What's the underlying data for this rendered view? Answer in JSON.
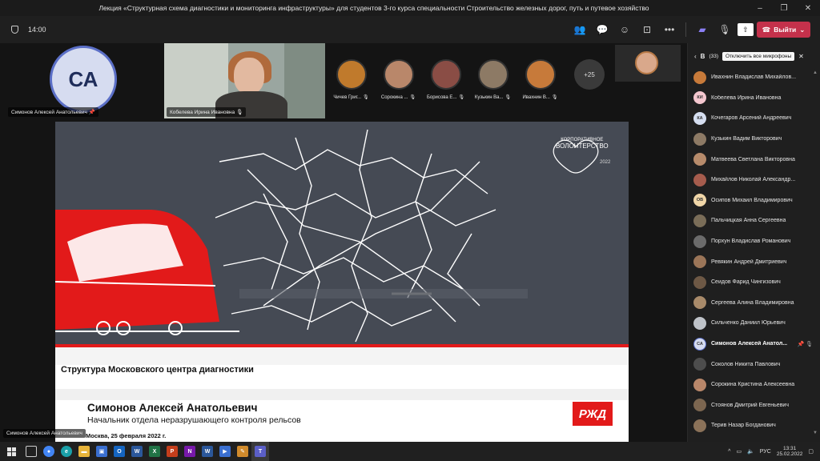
{
  "window": {
    "title": "Лекция «Структурная схема диагностики и мониторинга инфраструктуры» для студентов 3-го курса специальности Строительство железных дорог, путь и путевое хозяйство",
    "controls": [
      "–",
      "❐",
      "✕"
    ]
  },
  "toolbar": {
    "timer": "14:00",
    "leave_label": "Выйти",
    "icons": [
      "people-icon",
      "chat-icon",
      "reactions-icon",
      "rooms-icon",
      "more-icon",
      "camera-off-icon",
      "mic-off-icon",
      "share-icon"
    ]
  },
  "stage": {
    "main_tile_initials": "СА",
    "main_tile_name": "Симонов Алексей Анатольевич",
    "kobeleva_name": "Кобелева Ирина Ивановна",
    "participants": [
      {
        "name": "Чичев Григ...",
        "color": "#c07a2c"
      },
      {
        "name": "Сорокина ...",
        "color": "#b9876a"
      },
      {
        "name": "Борисова Е...",
        "color": "#8a4d45"
      },
      {
        "name": "Кузькин Ва...",
        "color": "#8d7a65"
      },
      {
        "name": "Ивахнин В...",
        "color": "#c77a3a"
      }
    ],
    "more_count": "+25",
    "bottom_name": "Симонов Алексей Анатольевич"
  },
  "slide": {
    "logo_text_top": "КОРПОРАТИВНОЕ",
    "logo_text_main": "ВОЛОНТЕРСТВО",
    "logo_year": "2022",
    "title": "Структура Московского центра диагностики",
    "name": "Симонов Алексей Анатольевич",
    "position": "Начальник отдела неразрушающего контроля рельсов",
    "date": "Москва, 25 февраля 2022 г.",
    "rzd_logo": "РЖД"
  },
  "panel": {
    "header": "В",
    "count": "(33)",
    "tooltip": "Отключить все микрофоны",
    "people": [
      {
        "name": "Ивахнин Владислав Михайлов...",
        "initials": "",
        "color": "#c77a3a"
      },
      {
        "name": "Кобелева Ирина Ивановна",
        "initials": "КИ",
        "color": "#f4c7cf"
      },
      {
        "name": "Кочегаров Арсений Андреевич",
        "initials": "КА",
        "color": "#d5def0"
      },
      {
        "name": "Кузькин Вадим Викторович",
        "initials": "",
        "color": "#8d7a65"
      },
      {
        "name": "Матвеева Светлана Викторовна",
        "initials": "",
        "color": "#b78b6b"
      },
      {
        "name": "Михайлов Николай Александр...",
        "initials": "",
        "color": "#a65c4d"
      },
      {
        "name": "Осипов Михаил Владимирович",
        "initials": "ОВ",
        "color": "#f0d6a8"
      },
      {
        "name": "Пальчицкая Анна Сергеевна",
        "initials": "",
        "color": "#7a6d58"
      },
      {
        "name": "Порхун Владислав Романович",
        "initials": "",
        "color": "#6b6b6b"
      },
      {
        "name": "Ревякин Андрей Дмитриевич",
        "initials": "",
        "color": "#9b7558"
      },
      {
        "name": "Сеидов Фарид Чингизович",
        "initials": "",
        "color": "#6d5845"
      },
      {
        "name": "Сергеева Алина Владимировна",
        "initials": "",
        "color": "#a88a6a"
      },
      {
        "name": "Сильченко Даниил Юрьевич",
        "initials": "",
        "color": "#bfc3c9"
      },
      {
        "name": "Симонов Алексей Анатол...",
        "initials": "СА",
        "color": "#d6dcf0",
        "bold": true
      },
      {
        "name": "Соколов Никита Павлович",
        "initials": "",
        "color": "#4d4d4d"
      },
      {
        "name": "Сорокина Кристина Алексеевна",
        "initials": "",
        "color": "#b9876a"
      },
      {
        "name": "Стоянов Дмитрий Евгеньевич",
        "initials": "",
        "color": "#7c6650"
      },
      {
        "name": "Терив Назар Богданович",
        "initials": "",
        "color": "#8b7259"
      }
    ]
  },
  "taskbar": {
    "apps": [
      {
        "name": "chrome",
        "letter": "●",
        "color": "#4285f4"
      },
      {
        "name": "edge",
        "letter": "e",
        "color": "#1aa0a8"
      },
      {
        "name": "explorer",
        "letter": "▬",
        "color": "#e8b43a"
      },
      {
        "name": "store",
        "letter": "▣",
        "color": "#3a6fd0"
      },
      {
        "name": "outlook",
        "letter": "O",
        "color": "#1565c0"
      },
      {
        "name": "word",
        "letter": "W",
        "color": "#2b579a"
      },
      {
        "name": "excel",
        "letter": "X",
        "color": "#217346"
      },
      {
        "name": "powerpoint",
        "letter": "P",
        "color": "#c43e1c"
      },
      {
        "name": "onenote",
        "letter": "N",
        "color": "#7719aa"
      },
      {
        "name": "word2",
        "letter": "W",
        "color": "#2b579a"
      },
      {
        "name": "video",
        "letter": "▶",
        "color": "#3a6fd0"
      },
      {
        "name": "paint",
        "letter": "✎",
        "color": "#d08a2c"
      },
      {
        "name": "teams",
        "letter": "T",
        "color": "#5b5fc7"
      }
    ],
    "lang": "РУС",
    "time": "13:31",
    "date": "25.02.2022"
  }
}
